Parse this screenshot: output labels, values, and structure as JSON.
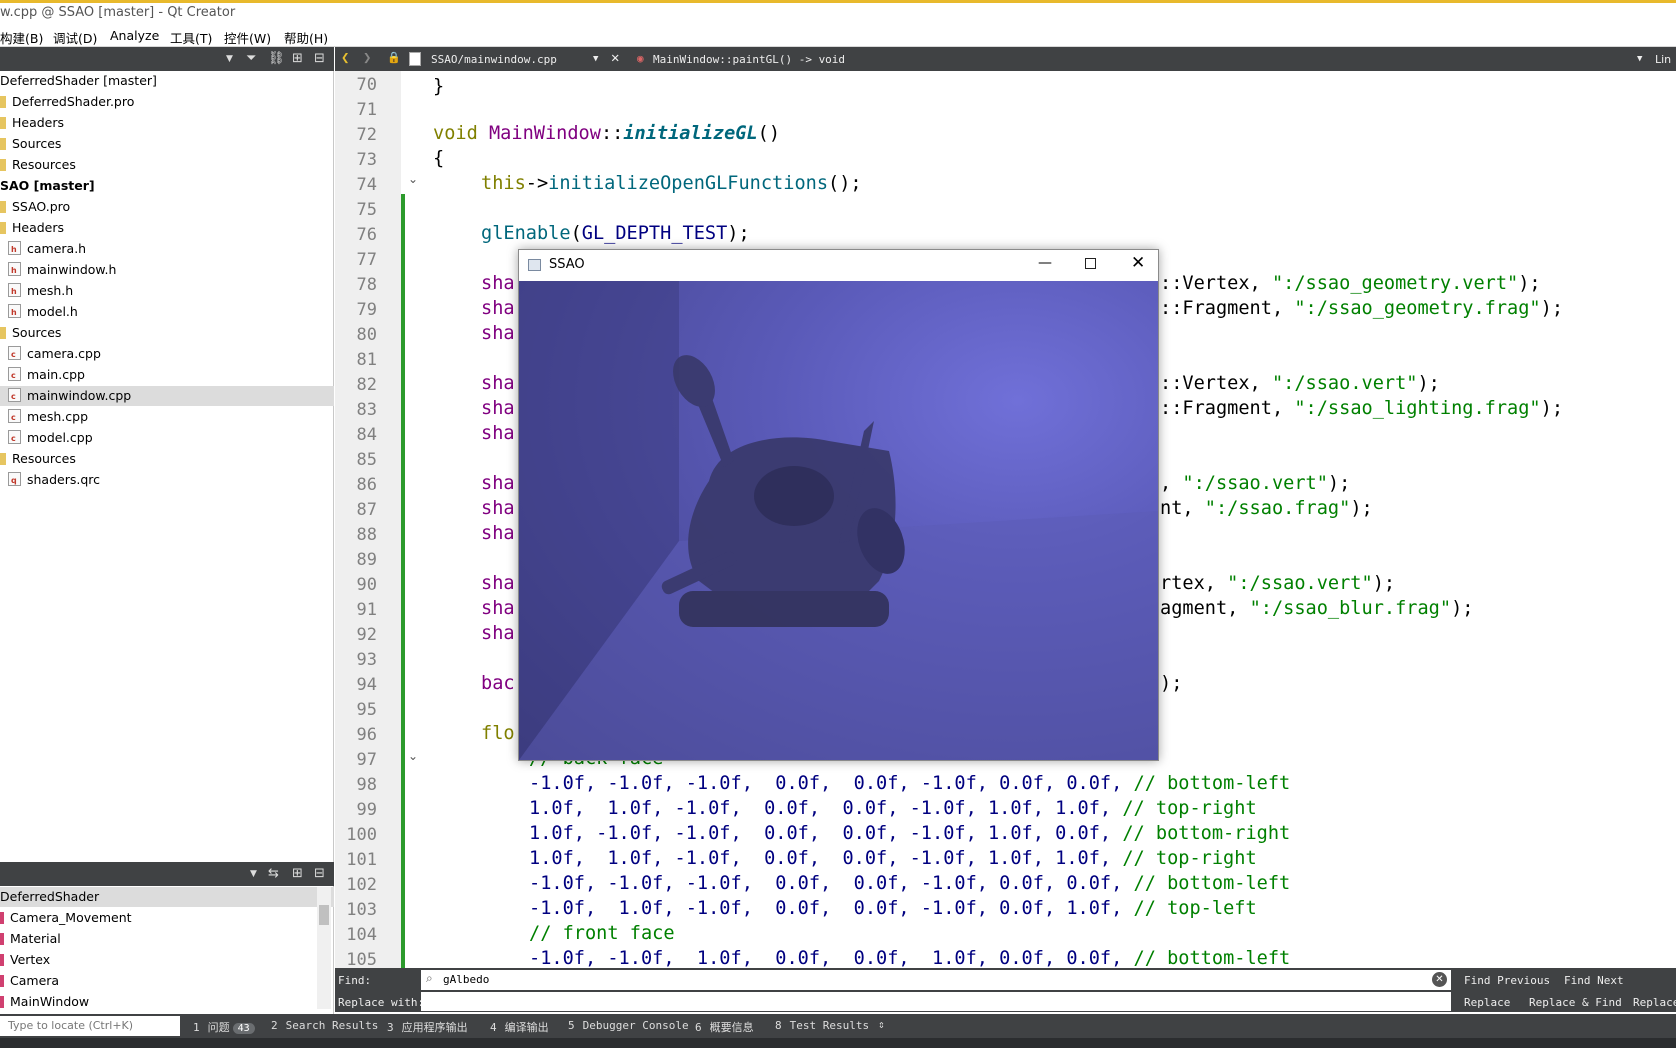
{
  "window": {
    "title": "w.cpp @ SSAO [master] - Qt Creator"
  },
  "menu": [
    "构建(B)",
    "调试(D)",
    "Analyze",
    "工具(T)",
    "控件(W)",
    "帮助(H)"
  ],
  "project_tree": [
    {
      "label": "DeferredShader [master]",
      "kind": "project"
    },
    {
      "label": "DeferredShader.pro",
      "kind": "pro"
    },
    {
      "label": "Headers",
      "kind": "folder"
    },
    {
      "label": "Sources",
      "kind": "folder"
    },
    {
      "label": "Resources",
      "kind": "folder"
    },
    {
      "label": "SAO [master]",
      "kind": "project"
    },
    {
      "label": "SSAO.pro",
      "kind": "pro"
    },
    {
      "label": "Headers",
      "kind": "folder"
    },
    {
      "label": "camera.h",
      "kind": "h"
    },
    {
      "label": "mainwindow.h",
      "kind": "h"
    },
    {
      "label": "mesh.h",
      "kind": "h"
    },
    {
      "label": "model.h",
      "kind": "h"
    },
    {
      "label": "Sources",
      "kind": "folder"
    },
    {
      "label": "camera.cpp",
      "kind": "cpp"
    },
    {
      "label": "main.cpp",
      "kind": "cpp"
    },
    {
      "label": "mainwindow.cpp",
      "kind": "cpp",
      "selected": true
    },
    {
      "label": "mesh.cpp",
      "kind": "cpp"
    },
    {
      "label": "model.cpp",
      "kind": "cpp"
    },
    {
      "label": "Resources",
      "kind": "folder"
    },
    {
      "label": "shaders.qrc",
      "kind": "qrc"
    }
  ],
  "class_view": {
    "root": "DeferredShader",
    "items": [
      "Camera_Movement",
      "Material",
      "Vertex",
      "Camera",
      "MainWindow"
    ]
  },
  "editor": {
    "file_tab": "SSAO/mainwindow.cpp",
    "symbol": "MainWindow::paintGL() -> void",
    "right_label": "Lin",
    "line_numbers": [
      "70",
      "71",
      "72",
      "73",
      "74",
      "75",
      "76",
      "77",
      "78",
      "79",
      "80",
      "81",
      "82",
      "83",
      "84",
      "85",
      "86",
      "87",
      "88",
      "89",
      "90",
      "91",
      "92",
      "93",
      "94",
      "95",
      "96",
      "97",
      "98",
      "99",
      "100",
      "101",
      "102",
      "103",
      "104",
      "105"
    ],
    "code": {
      "l70": "}",
      "l72_kw": "void ",
      "l72_cls": "MainWindow",
      "l72_sep": "::",
      "l72_fn": "initializeGL",
      "l72_end": "()",
      "l73": "{",
      "l74_kw": "this",
      "l74_arrow": "->",
      "l74_call": "initializeOpenGLFunctions",
      "l74_end": "();",
      "l76_call": "glEnable",
      "l76_a": "(",
      "l76_macro": "GL_DEPTH_TEST",
      "l76_end": ");",
      "sha": "sha",
      "l78_r": "::Vertex, ",
      "l78_s": "\":/ssao_geometry.vert\"",
      "l78_e": ");",
      "l79_r": "::Fragment, ",
      "l79_s": "\":/ssao_geometry.frag\"",
      "l79_e": ");",
      "l82_r": "::Vertex, ",
      "l82_s": "\":/ssao.vert\"",
      "l82_e": ");",
      "l83_r": "::Fragment, ",
      "l83_s": "\":/ssao_lighting.frag\"",
      "l83_e": ");",
      "l86_r": ", ",
      "l86_s": "\":/ssao.vert\"",
      "l86_e": ");",
      "l87_r": "nt, ",
      "l87_s": "\":/ssao.frag\"",
      "l87_e": ");",
      "l90_r": "rtex, ",
      "l90_s": "\":/ssao.vert\"",
      "l90_e": ");",
      "l91_r": "agment, ",
      "l91_s": "\":/ssao_blur.frag\"",
      "l91_e": ");",
      "l94_a": "bac",
      "l94_r": ");",
      "l96_a": "flo",
      "l97": "// back face",
      "l98": "-1.0f, -1.0f, -1.0f,  0.0f,  0.0f, -1.0f, 0.0f, 0.0f,",
      "l98_c": "// bottom-left",
      "l99": "1.0f,  1.0f, -1.0f,  0.0f,  0.0f, -1.0f, 1.0f, 1.0f,",
      "l99_c": "// top-right",
      "l100": "1.0f, -1.0f, -1.0f,  0.0f,  0.0f, -1.0f, 1.0f, 0.0f,",
      "l100_c": "// bottom-right",
      "l101": "1.0f,  1.0f, -1.0f,  0.0f,  0.0f, -1.0f, 1.0f, 1.0f,",
      "l101_c": "// top-right",
      "l102": "-1.0f, -1.0f, -1.0f,  0.0f,  0.0f, -1.0f, 0.0f, 0.0f,",
      "l102_c": "// bottom-left",
      "l103": "-1.0f,  1.0f, -1.0f,  0.0f,  0.0f, -1.0f, 0.0f, 1.0f,",
      "l103_c": "// top-left",
      "l104": "// front face",
      "l105": "-1.0f, -1.0f,  1.0f,  0.0f,  0.0f,  1.0f, 0.0f, 0.0f,",
      "l105_c": "// bottom-left"
    }
  },
  "ssao_window": {
    "title": "SSAO"
  },
  "find": {
    "find_label": "Find:",
    "replace_label": "Replace with:",
    "find_value": "gAlbedo",
    "replace_value": "",
    "find_previous": "Find Previous",
    "find_next": "Find Next",
    "replace": "Replace",
    "replace_find": "Replace & Find",
    "replace_all": "Replace"
  },
  "statusbar": {
    "locator_placeholder": "Type to locate (Ctrl+K)",
    "tabs": [
      {
        "num": "1",
        "label": "问题",
        "badge": "43"
      },
      {
        "num": "2",
        "label": "Search Results"
      },
      {
        "num": "3",
        "label": "应用程序输出"
      },
      {
        "num": "4",
        "label": "编译输出"
      },
      {
        "num": "5",
        "label": "Debugger Console"
      },
      {
        "num": "6",
        "label": "概要信息"
      },
      {
        "num": "8",
        "label": "Test Results"
      }
    ]
  },
  "colors": {
    "keyword": "#808000",
    "class": "#800080",
    "function": "#00677c",
    "string": "#008000",
    "number": "#000080",
    "panel": "#404244"
  }
}
